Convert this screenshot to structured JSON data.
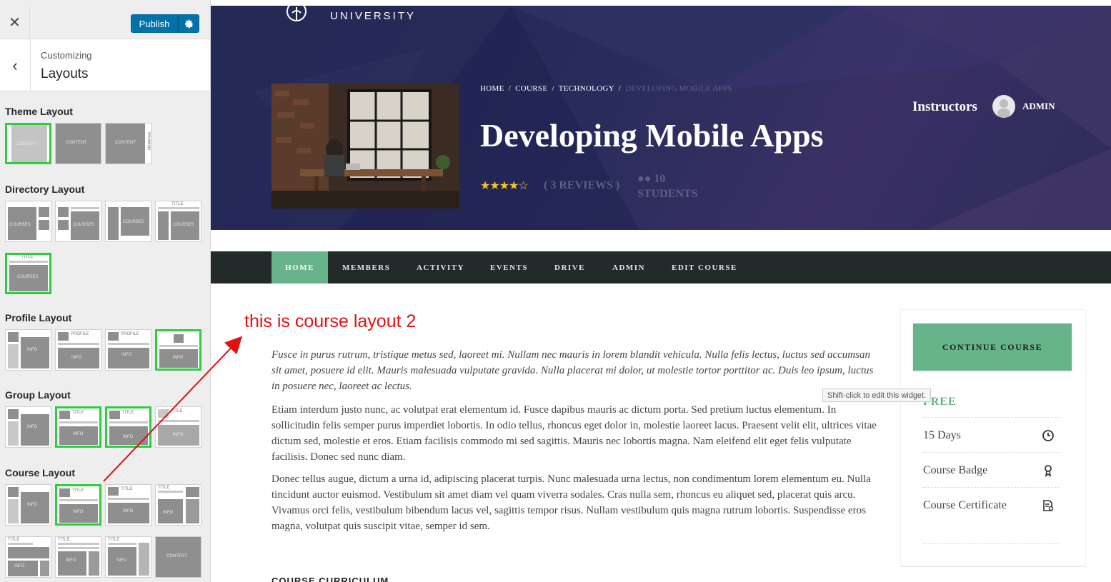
{
  "customizer": {
    "close_label": "✕",
    "publish_label": "Publish",
    "customizing_label": "Customizing",
    "section_title": "Layouts",
    "sections": [
      {
        "title": "Theme Layout"
      },
      {
        "title": "Directory Layout"
      },
      {
        "title": "Profile Layout"
      },
      {
        "title": "Group Layout"
      },
      {
        "title": "Course Layout"
      }
    ],
    "thumb_labels": {
      "content": "CONTENT",
      "boundary": "Boundary",
      "courses": "COURSES",
      "title": "TITLE",
      "info": "INFO",
      "profile": "PROFILE"
    }
  },
  "site": {
    "logo_text": "UNIVERSITY"
  },
  "course": {
    "breadcrumb": {
      "home": "HOME",
      "course": "COURSE",
      "category": "TECHNOLOGY",
      "current": "DEVELOPING MOBILE APPS",
      "sep": "/"
    },
    "title": "Developing Mobile Apps",
    "rating": 4.5,
    "reviews": "( 3 REVIEWS )",
    "students": "10 STUDENTS",
    "instructors_label": "Instructors",
    "instructor_name": "ADMIN"
  },
  "nav": {
    "items": [
      "HOME",
      "MEMBERS",
      "ACTIVITY",
      "EVENTS",
      "DRIVE",
      "ADMIN",
      "EDIT COURSE"
    ],
    "active": 0
  },
  "annotation": {
    "text": "this is course layout 2"
  },
  "content": {
    "intro": "Fusce in purus rutrum, tristique metus sed, laoreet mi. Nullam nec mauris in lorem blandit vehicula. Nulla felis lectus, luctus sed accumsan sit amet, posuere id elit. Mauris malesuada vulputate gravida. Nulla placerat mi dolor, ut molestie tortor porttitor ac. Duis leo ipsum, luctus in posuere nec, laoreet ac lectus.",
    "paragraph_1": "Etiam interdum justo nunc, ac volutpat erat elementum id. Fusce dapibus mauris ac dictum porta. Sed pretium luctus elementum. In sollicitudin felis semper purus imperdiet lobortis. In odio tellus, rhoncus eget dolor in, molestie laoreet lacus. Praesent velit elit, ultrices vitae dictum sed, molestie et eros. Etiam facilisis commodo mi sed sagittis. Mauris nec lobortis magna. Nam eleifend elit eget felis vulputate facilisis. Donec sed nunc diam.",
    "paragraph_2": "Donec tellus augue, dictum a urna id, adipiscing placerat turpis. Nunc malesuada urna lectus, non condimentum lorem elementum eu. Nulla tincidunt auctor euismod. Vestibulum sit amet diam vel quam viverra sodales. Cras nulla sem, rhoncus eu aliquet sed, placerat quis arcu. Vivamus orci felis, vestibulum bibendum lacus vel, sagittis tempor risus. Nullam vestibulum quis magna rutrum lobortis. Suspendisse eros magna, volutpat quis suscipit vitae, semper id sem.",
    "curriculum_heading": "COURSE CURRICULUM"
  },
  "sidebar_card": {
    "continue_label": "CONTINUE COURSE",
    "tooltip": "Shift-click to edit this widget.",
    "price": "FREE",
    "meta": [
      {
        "text": "15 Days",
        "icon": "clock-icon"
      },
      {
        "text": "Course Badge",
        "icon": "badge-icon"
      },
      {
        "text": "Course Certificate",
        "icon": "certificate-icon"
      }
    ]
  },
  "colors": {
    "accent_green": "#67b38a",
    "publish_blue": "#0073aa",
    "selected_outline": "#2ecc40",
    "annotation_red": "#e41010",
    "hero_dark": "#23264f",
    "nav_dark": "#232a2a"
  }
}
